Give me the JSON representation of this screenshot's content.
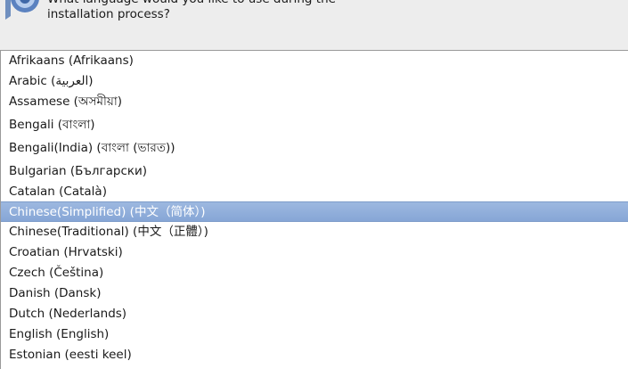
{
  "header": {
    "prompt": "What language would you like to use during the\ninstallation process?"
  },
  "languages": [
    {
      "label": "Afrikaans (Afrikaans)"
    },
    {
      "label": "Arabic (العربية)"
    },
    {
      "label": "Assamese (অসমীয়া)"
    },
    {
      "label": "Bengali (বাংলা)"
    },
    {
      "label": "Bengali(India) (বাংলা (ভারত))"
    },
    {
      "label": "Bulgarian (Български)"
    },
    {
      "label": "Catalan (Català)"
    },
    {
      "label": "Chinese(Simplified) (中文（简体）)",
      "selected": true
    },
    {
      "label": "Chinese(Traditional) (中文（正體）)"
    },
    {
      "label": "Croatian (Hrvatski)"
    },
    {
      "label": "Czech (Čeština)"
    },
    {
      "label": "Danish (Dansk)"
    },
    {
      "label": "Dutch (Nederlands)"
    },
    {
      "label": "English (English)"
    },
    {
      "label": "Estonian (eesti keel)"
    }
  ],
  "colors": {
    "selection": "#8fadd9",
    "background": "#ededed",
    "list_background": "#ffffff"
  },
  "icons": {
    "header": "installer-globe-icon"
  }
}
